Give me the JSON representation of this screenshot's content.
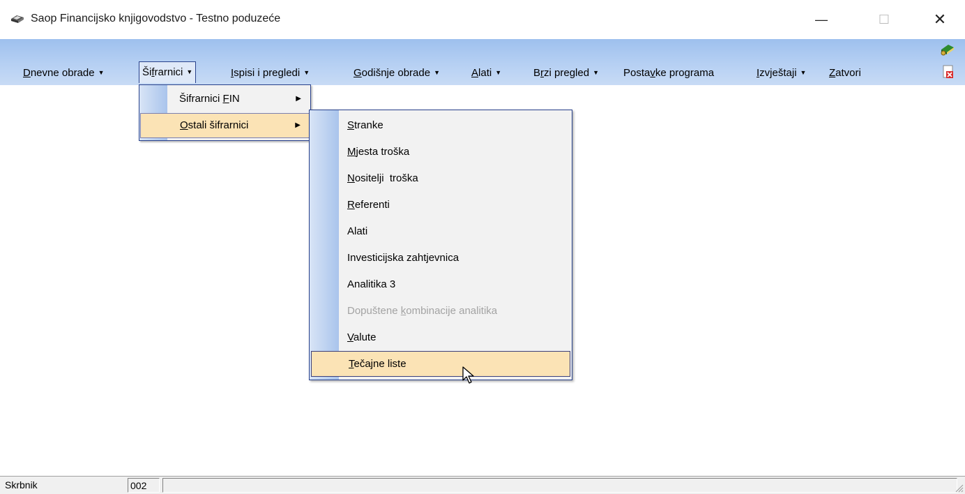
{
  "window": {
    "title": "Saop Financijsko knjigovodstvo - Testno poduzeće",
    "minimize_glyph": "—",
    "maximize_glyph": "☐",
    "close_glyph": "✕"
  },
  "menubar": {
    "items": [
      {
        "pre": "",
        "key": "D",
        "post": "nevne obrade",
        "has_dropdown": true
      },
      {
        "pre": "Ši",
        "key": "f",
        "post": "rarnici",
        "has_dropdown": true,
        "active": true
      },
      {
        "pre": "",
        "key": "I",
        "post": "spisi i pregledi",
        "has_dropdown": true
      },
      {
        "pre": "",
        "key": "G",
        "post": "odišnje obrade",
        "has_dropdown": true
      },
      {
        "pre": "",
        "key": "A",
        "post": "lati",
        "has_dropdown": true
      },
      {
        "pre": "B",
        "key": "r",
        "post": "zi pregled",
        "has_dropdown": true
      },
      {
        "pre": "Posta",
        "key": "v",
        "post": "ke programa",
        "has_dropdown": false
      },
      {
        "pre": "",
        "key": "I",
        "post": "zvještaji",
        "has_dropdown": true
      },
      {
        "pre": "",
        "key": "Z",
        "post": "atvori",
        "has_dropdown": false
      }
    ],
    "dropdown_glyph": "▼",
    "side_icons": [
      "books-icon",
      "close-document-icon"
    ]
  },
  "dropdown_sifrarnici": {
    "items": [
      {
        "pre": "Šifrarnici ",
        "key": "F",
        "post": "IN",
        "submenu": true
      },
      {
        "pre": "",
        "key": "O",
        "post": "stali šifrarnici",
        "submenu": true,
        "highlighted": true
      }
    ],
    "submenu_glyph": "▶"
  },
  "dropdown_ostali": {
    "items": [
      {
        "pre": "",
        "key": "S",
        "post": "tranke",
        "state": "normal"
      },
      {
        "pre": "",
        "key": "M",
        "post": "jesta troška",
        "state": "normal"
      },
      {
        "pre": "",
        "key": "N",
        "post": "ositelji  troška",
        "state": "normal"
      },
      {
        "pre": "",
        "key": "R",
        "post": "eferenti",
        "state": "normal"
      },
      {
        "pre": "Alati",
        "key": "",
        "post": "",
        "state": "normal"
      },
      {
        "pre": "Investicijska zahtjevnica",
        "key": "",
        "post": "",
        "state": "normal"
      },
      {
        "pre": "Analitika 3",
        "key": "",
        "post": "",
        "state": "normal"
      },
      {
        "pre": "Dopuštene ",
        "key": "k",
        "post": "ombinacije analitika",
        "state": "disabled"
      },
      {
        "pre": "",
        "key": "V",
        "post": "alute",
        "state": "normal"
      },
      {
        "pre": "",
        "key": "T",
        "post": "ečajne liste",
        "state": "hover"
      }
    ]
  },
  "statusbar": {
    "user": "Skrbnik",
    "code": "002",
    "message": ""
  }
}
